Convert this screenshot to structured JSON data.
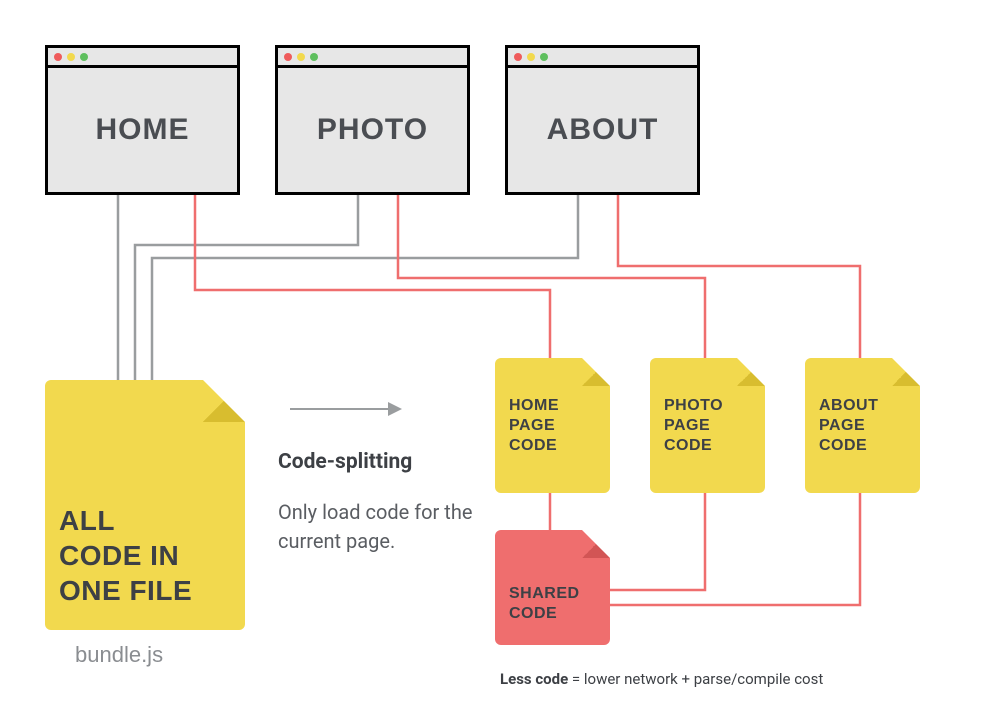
{
  "browsers": {
    "home": "HOME",
    "photo": "PHOTO",
    "about": "ABOUT"
  },
  "bundle": {
    "label_line1": "ALL",
    "label_line2": "CODE IN",
    "label_line3": "ONE FILE",
    "caption": "bundle.js"
  },
  "codesplit": {
    "title": "Code-splitting",
    "desc": "Only load code for the current page."
  },
  "chunks": {
    "home_l1": "HOME",
    "home_l2": "PAGE",
    "home_l3": "CODE",
    "photo_l1": "PHOTO",
    "photo_l2": "PAGE",
    "photo_l3": "CODE",
    "about_l1": "ABOUT",
    "about_l2": "PAGE",
    "about_l3": "CODE",
    "shared_l1": "SHARED",
    "shared_l2": "CODE"
  },
  "footnote": {
    "bold": "Less code",
    "rest": " = lower network + parse/compile cost"
  }
}
